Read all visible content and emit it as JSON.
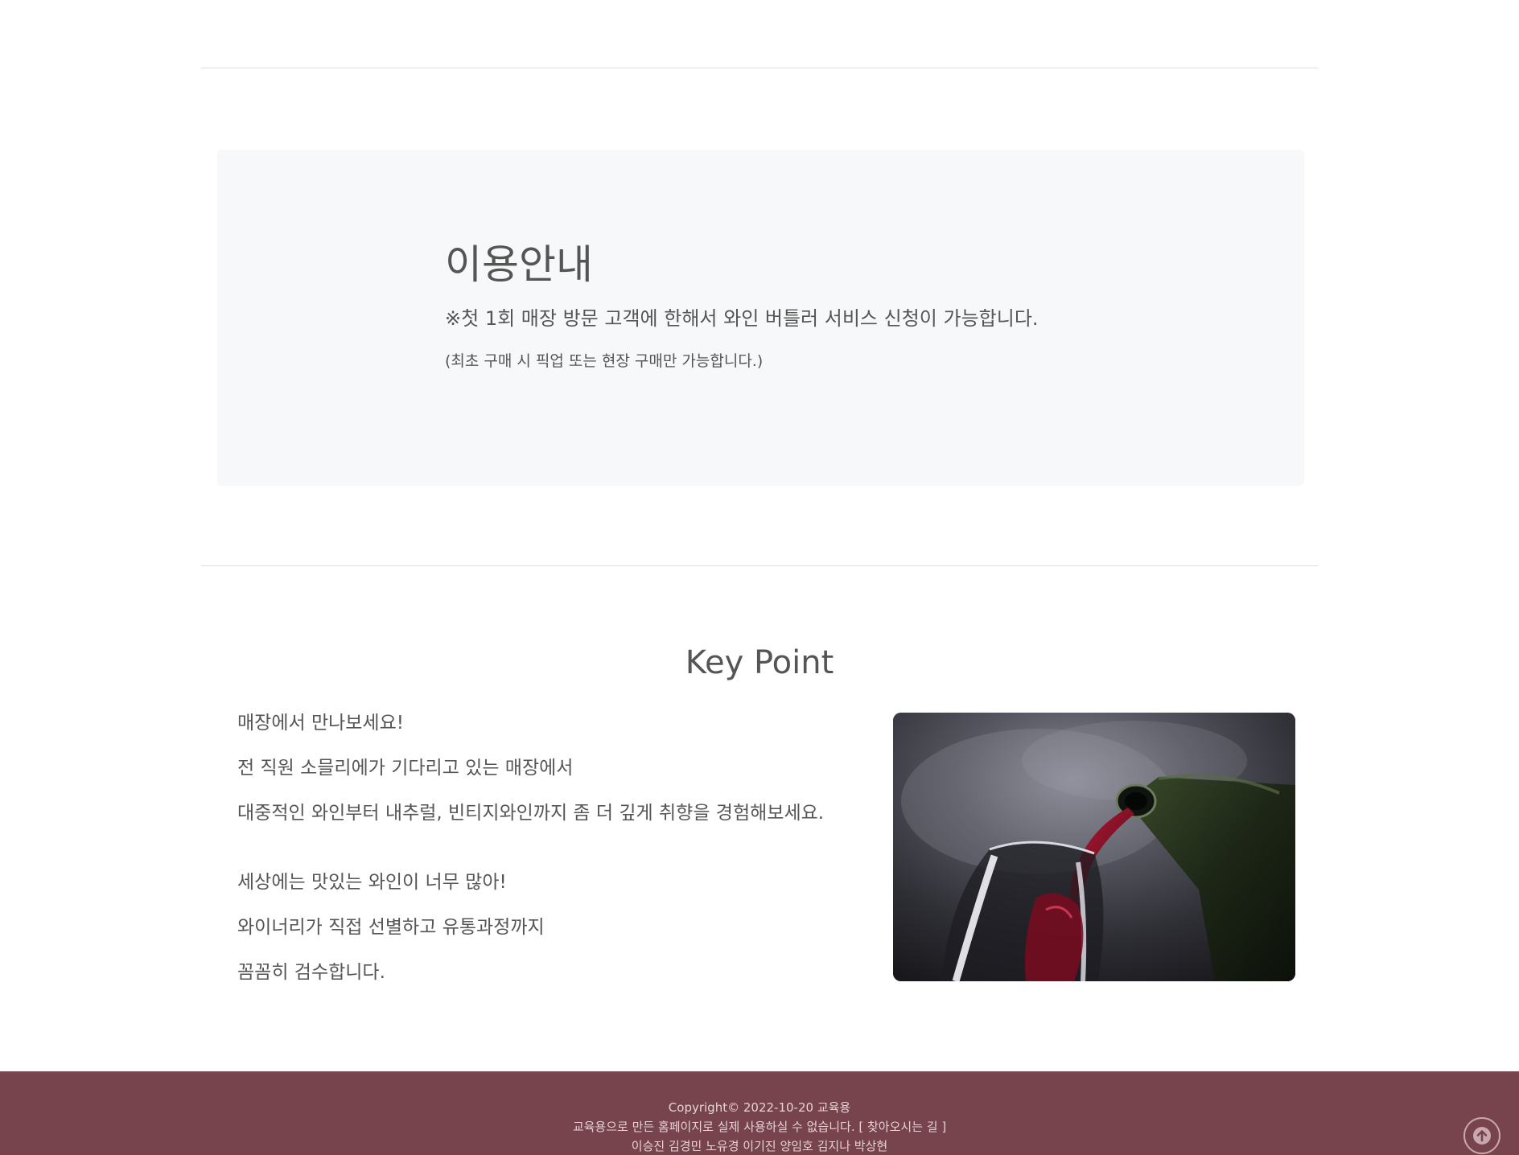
{
  "info": {
    "title": "이용안내",
    "text": "※첫 1회 매장 방문 고객에 한해서 와인 버틀러 서비스 신청이 가능합니다.",
    "sub": "(최초 구매 시 픽업 또는 현장 구매만 가능합니다.)"
  },
  "keypoint": {
    "title": "Key Point",
    "lines": [
      "매장에서 만나보세요!",
      "전 직원 소믈리에가 기다리고 있는 매장에서",
      "대중적인 와인부터 내추럴, 빈티지와인까지 좀 더 깊게 취향을 경험해보세요.",
      "세상에는 맛있는 와인이 너무 많아!",
      "와이너리가 직접 선별하고 유통과정까지",
      "꼼꼼히 검수합니다."
    ],
    "image_subject": "red wine pouring into a glass from a bottle"
  },
  "footer": {
    "copyright": "Copyright© 2022-10-20 교육용",
    "notice": "교육용으로 만든 홈페이지로 실제 사용하실 수 없습니다.",
    "link": "[ 찾아오시는 길 ]",
    "members": "이승진 김경민 노유경 이기진 양임호 김지나 박상현"
  },
  "scroll_top": {
    "icon": "arrow-up-circle-icon"
  },
  "colors": {
    "footer_bg": "#77434d",
    "info_box_bg": "#f7f8f9",
    "text": "#555555"
  }
}
